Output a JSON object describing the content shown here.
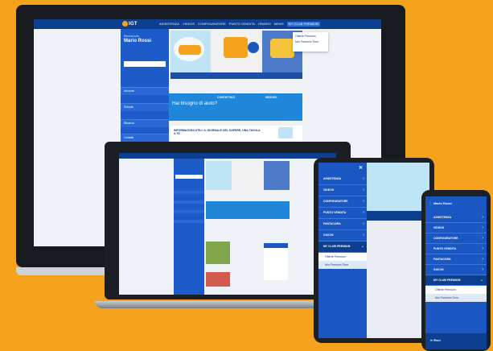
{
  "brand": {
    "logo_text": "IGT",
    "accent": "#f5a31c",
    "primary": "#1a57c2",
    "dark": "#0c3f8f"
  },
  "desktop": {
    "nav": [
      "ASSISTENZA",
      "VIDEOS",
      "CONFIGURATORE",
      "PUNTO VENDITA",
      "ORARIO",
      "NEWS",
      "MY CLUB PREMIUM"
    ],
    "sidebar": {
      "greeting": "Benvenuto",
      "user_name": "Mario Rossi",
      "items": [
        "Account",
        "Schede",
        "Ricarica",
        "Contatti"
      ]
    },
    "info_title": "Hai bisogno di aiuto?",
    "info_heading_1": "CONTATTACI",
    "info_heading_2": "SEGUICI",
    "news_title": "INFORMAZIONI UTILI: IL GIORNALE DEL SAPERE, UNA TAVOLA A TE",
    "dropdown": [
      "Offerte Premium",
      "Mio Premium Time"
    ]
  },
  "tablet": {
    "menu": [
      "ASSISTENZA",
      "VIDEOS",
      "CONFIGURATORE",
      "PUNTO VENDITA",
      "FANTACORA",
      "GIOCHI",
      "MY CLUB PREMIUM"
    ],
    "submenu": [
      "Offerte Premium",
      "Mio Premium Time"
    ]
  },
  "phone": {
    "user": "Mario Rossi",
    "menu": [
      "ASSISTENZA",
      "VIDEOS",
      "CONFIGURATORE",
      "PUNTO VENDITA",
      "FANTACORA",
      "GIOCHI",
      "MY CLUB PREMIUM"
    ],
    "submenu": [
      "Offerte Premium",
      "Mio Premium Time"
    ],
    "exit": "Esci"
  }
}
